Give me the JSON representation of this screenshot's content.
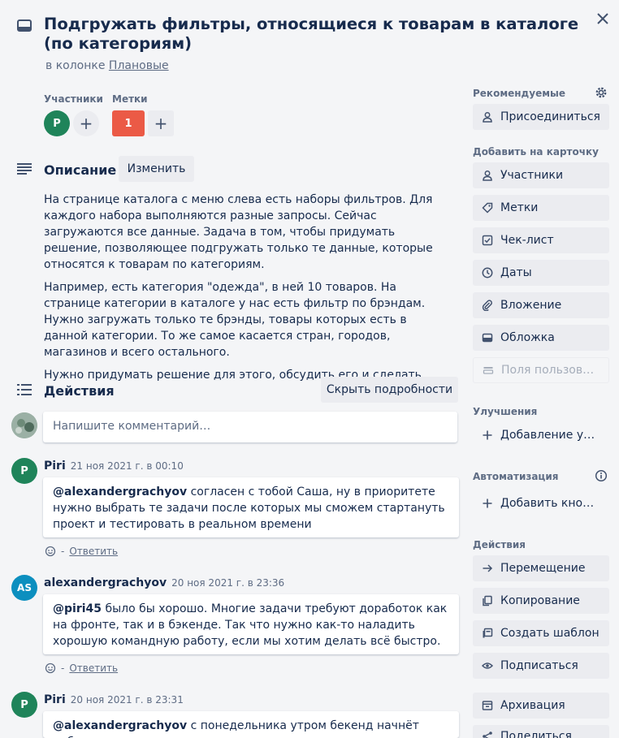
{
  "card": {
    "title": "Подгружать фильтры, относящиеся к товарам в каталоге (по категориям)",
    "in_column_prefix": "в колонке",
    "column_name": "Плановые"
  },
  "members": {
    "label": "Участники",
    "avatar_initial": "P",
    "avatar_color": "#1f845a"
  },
  "labels": {
    "label": "Метки",
    "items": [
      {
        "text": "1",
        "color": "#eb5a46"
      }
    ]
  },
  "description": {
    "heading": "Описание",
    "edit_label": "Изменить",
    "paragraphs": [
      "На странице каталога с меню слева есть наборы фильтров. Для каждого набора выполняются разные запросы. Сейчас загружаются все данные. Задача в том, чтобы придумать решение, позволяющее подгружать только те данные, которые относятся к товарам по категориям.",
      "Например, есть категория \"одежда\", в ней 10 товаров. На странице категории в каталоге у нас есть фильтр по брэндам. Нужно загружать только те брэнды, товары которых есть в данной категории. То же самое касается стран, городов, магазинов и всего остального.",
      "Нужно придумать решение для этого, обсудить его и сделать."
    ]
  },
  "activity": {
    "heading": "Действия",
    "hide_details_label": "Скрыть подробности",
    "comment_placeholder": "Напишите комментарий…",
    "reply_label": "Ответить",
    "separator": "-",
    "comments": [
      {
        "author": "Piri",
        "initials": "P",
        "avatar_color": "#1f845a",
        "date": "21 ноя 2021 г. в 00:10",
        "mention": "@alexandergrachyov",
        "text": " согласен с тобой Саша, ну в приоритете нужно выбрать те задачи после которых мы сможем стартануть проект и тестировать в реальном времени"
      },
      {
        "author": "alexandergrachyov",
        "initials": "AS",
        "avatar_color": "#0c8fbf",
        "date": "20 ноя 2021 г. в 23:36",
        "mention": "@piri45",
        "text": " было бы хорошо. Многие задачи требуют доработок как на фронте, так и в бэкенде. Так что нужно как-то наладить хорошую командную работу, если мы хотим делать всё быстро."
      },
      {
        "author": "Piri",
        "initials": "P",
        "avatar_color": "#1f845a",
        "date": "20 ноя 2021 г. в 23:31",
        "mention": "@alexandergrachyov",
        "text": " с понедельника утром бекенд начнёт работу,"
      }
    ]
  },
  "sidebar": {
    "suggested": {
      "heading": "Рекомендуемые",
      "join_label": "Присоединиться"
    },
    "add_to_card": {
      "heading": "Добавить на карточку",
      "items": [
        {
          "label": "Участники",
          "icon": "person-icon"
        },
        {
          "label": "Метки",
          "icon": "tag-icon"
        },
        {
          "label": "Чек-лист",
          "icon": "checklist-icon"
        },
        {
          "label": "Даты",
          "icon": "clock-icon"
        },
        {
          "label": "Вложение",
          "icon": "paperclip-icon"
        },
        {
          "label": "Обложка",
          "icon": "cover-icon"
        },
        {
          "label": "Поля пользоват…",
          "icon": "custom-fields-icon"
        }
      ]
    },
    "powerups": {
      "heading": "Улучшения",
      "add_label": "Добавление улу…"
    },
    "automation": {
      "heading": "Автоматизация",
      "add_button_label": "Добавить кнопку"
    },
    "actions": {
      "heading": "Действия",
      "items": [
        {
          "label": "Перемещение",
          "icon": "arrow-right-icon"
        },
        {
          "label": "Копирование",
          "icon": "copy-icon"
        },
        {
          "label": "Создать шаблон",
          "icon": "template-icon"
        },
        {
          "label": "Подписаться",
          "icon": "eye-icon"
        },
        {
          "label": "Архивация",
          "icon": "archive-icon"
        },
        {
          "label": "Поделиться",
          "icon": "share-icon"
        }
      ]
    }
  }
}
